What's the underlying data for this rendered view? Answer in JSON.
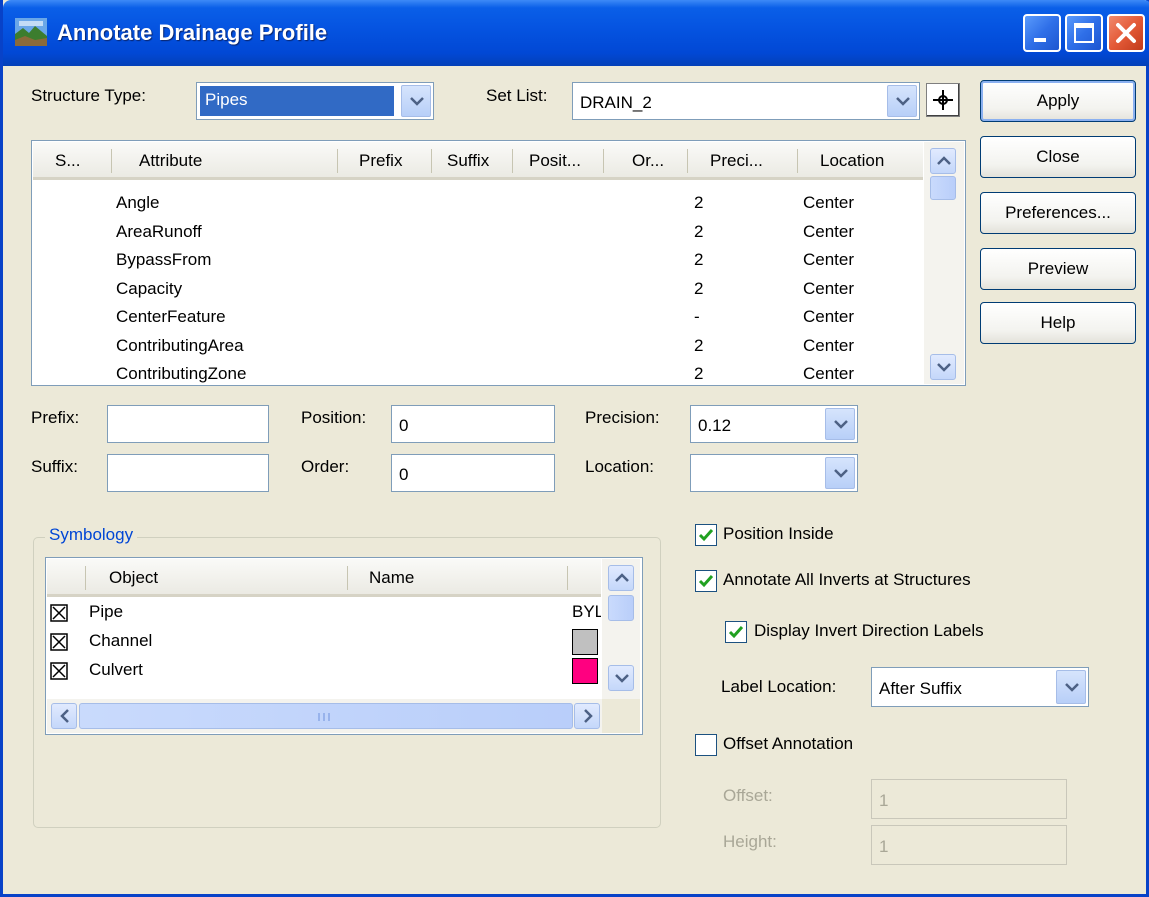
{
  "window": {
    "title": "Annotate Drainage Profile"
  },
  "structure_type": {
    "label": "Structure Type:",
    "value": "Pipes"
  },
  "set_list": {
    "label": "Set List:",
    "value": "DRAIN_2"
  },
  "buttons": {
    "apply": "Apply",
    "close": "Close",
    "preferences": "Preferences...",
    "preview": "Preview",
    "help": "Help"
  },
  "attributes_table": {
    "columns": [
      "S...",
      "Attribute",
      "Prefix",
      "Suffix",
      "Posit...",
      "Or...",
      "Preci...",
      "Location"
    ],
    "rows": [
      {
        "attribute": "Angle",
        "precision": "2",
        "location": "Center"
      },
      {
        "attribute": "AreaRunoff",
        "precision": "2",
        "location": "Center"
      },
      {
        "attribute": "BypassFrom",
        "precision": "2",
        "location": "Center"
      },
      {
        "attribute": "Capacity",
        "precision": "2",
        "location": "Center"
      },
      {
        "attribute": "CenterFeature",
        "precision": "-",
        "location": "Center"
      },
      {
        "attribute": "ContributingArea",
        "precision": "2",
        "location": "Center"
      },
      {
        "attribute": "ContributingZone",
        "precision": "2",
        "location": "Center"
      }
    ]
  },
  "fields": {
    "prefix_label": "Prefix:",
    "prefix_value": "",
    "suffix_label": "Suffix:",
    "suffix_value": "",
    "position_label": "Position:",
    "position_value": "0",
    "order_label": "Order:",
    "order_value": "0",
    "precision_label": "Precision:",
    "precision_value": "0.12",
    "location_label": "Location:",
    "location_value": ""
  },
  "symbology": {
    "title": "Symbology",
    "columns": [
      "Object",
      "Name"
    ],
    "rows": [
      {
        "object": "Pipe",
        "checked": true,
        "name": "BYL",
        "swatch": ""
      },
      {
        "object": "Channel",
        "checked": true,
        "name": "",
        "swatch": "#c0c0c0"
      },
      {
        "object": "Culvert",
        "checked": true,
        "name": "",
        "swatch": "#ff0080"
      }
    ]
  },
  "options": {
    "position_inside": {
      "label": "Position Inside",
      "checked": true
    },
    "annotate_all_inverts": {
      "label": "Annotate All Inverts at Structures",
      "checked": true
    },
    "display_invert_labels": {
      "label": "Display Invert Direction Labels",
      "checked": true
    },
    "label_location": {
      "label": "Label Location:",
      "value": "After Suffix"
    },
    "offset_annotation": {
      "label": "Offset Annotation",
      "checked": false
    },
    "offset": {
      "label": "Offset:",
      "value": "1"
    },
    "height": {
      "label": "Height:",
      "value": "1"
    }
  },
  "colors": {
    "titlebar": "#0553e0",
    "face": "#ece9d8",
    "accent": "#0046d5",
    "check": "#21a121"
  }
}
